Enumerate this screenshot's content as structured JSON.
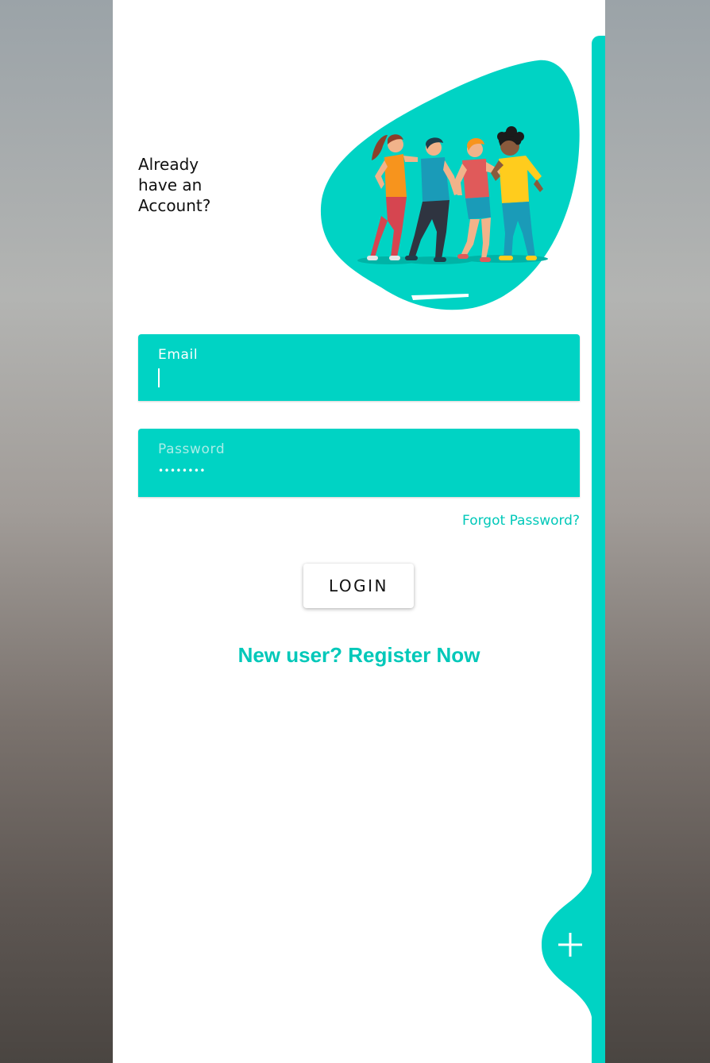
{
  "theme": {
    "accent": "#00d3c4",
    "accent_text": "#00c8b9",
    "background": "#ffffff",
    "text": "#111111"
  },
  "header": {
    "headline_line1": "Already",
    "headline_line2": "have an",
    "headline_line3": "Account?"
  },
  "hero": {
    "illustration": "group-of-friends-illustration"
  },
  "form": {
    "email": {
      "label": "Email",
      "value": ""
    },
    "password": {
      "label": "Password",
      "masked_value": "••••••••"
    },
    "forgot_label": "Forgot Password?",
    "login_label": "LOGIN",
    "register_label": "New user? Register Now"
  },
  "fab": {
    "icon": "plus-icon"
  }
}
